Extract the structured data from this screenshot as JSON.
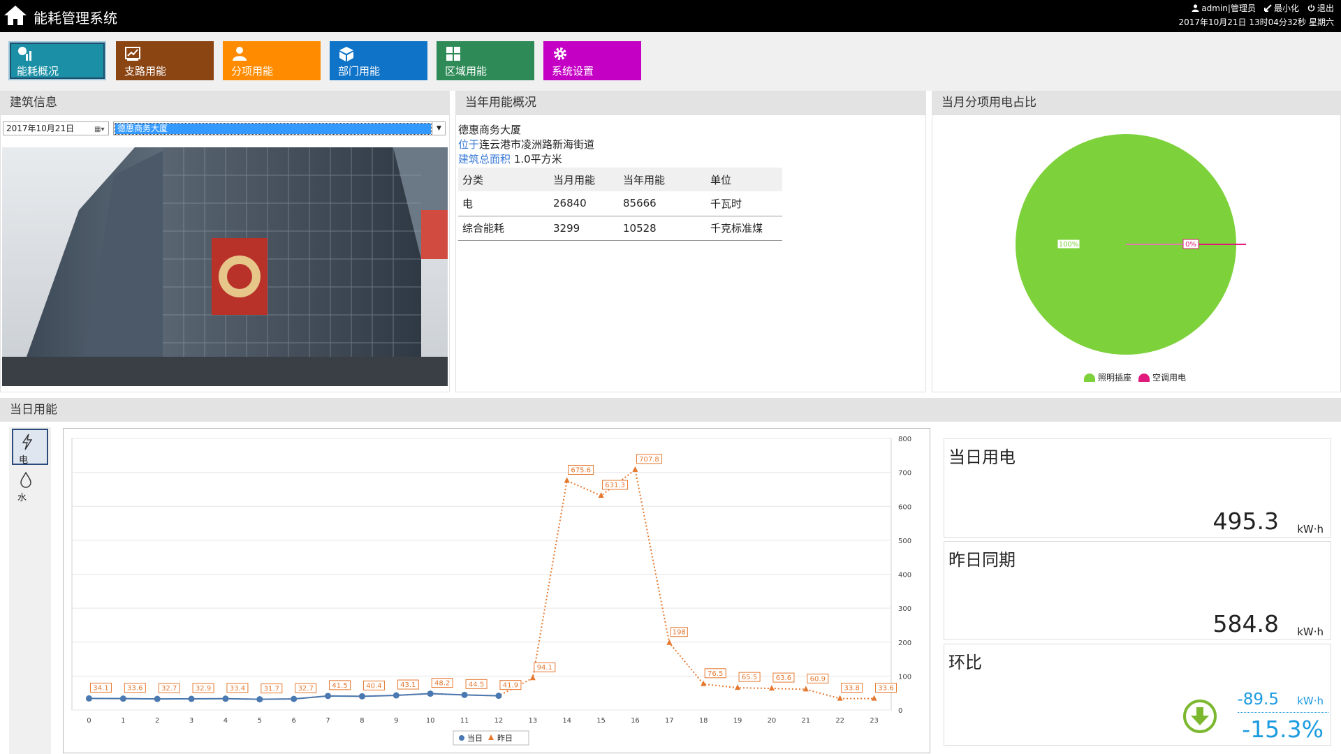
{
  "app": {
    "title": "能耗管理系统"
  },
  "user": {
    "user_label": "admin|管理员",
    "minimize_label": "最小化",
    "logout_label": "退出",
    "datetime": "2017年10月21日 13时04分32秒 星期六"
  },
  "nav": [
    {
      "label": "能耗概况",
      "color": "#1a8fa5",
      "icon": "dashboard-chart-icon",
      "active": true
    },
    {
      "label": "支路用能",
      "color": "#8b4513",
      "icon": "trend-chart-icon"
    },
    {
      "label": "分项用能",
      "color": "#ff8c00",
      "icon": "person-icon"
    },
    {
      "label": "部门用能",
      "color": "#0f73c8",
      "icon": "cube-icon"
    },
    {
      "label": "区域用能",
      "color": "#2e8b57",
      "icon": "grid-icon"
    },
    {
      "label": "系统设置",
      "color": "#c500c5",
      "icon": "gear-icon"
    }
  ],
  "building": {
    "header": "建筑信息",
    "date": "2017年10月21日",
    "selected": "德惠商务大厦"
  },
  "annual": {
    "header": "当年用能概况",
    "name": "德惠商务大厦",
    "loc_label": "位于",
    "loc_value": "连云港市凌洲路新海街道",
    "area_label": "建筑总面积",
    "area_value": " 1.0平方米",
    "columns": [
      "分类",
      "当月用能",
      "当年用能",
      "单位"
    ],
    "rows": [
      [
        "电",
        "26840",
        "85666",
        "千瓦时"
      ],
      [
        "综合能耗",
        "3299",
        "10528",
        "千克标准煤"
      ]
    ]
  },
  "pie": {
    "header": "当月分项用电占比",
    "chart_data": {
      "type": "pie",
      "slices": [
        {
          "name": "照明插座",
          "value": 100,
          "label": "100%",
          "color": "#7dd13a"
        },
        {
          "name": "空调用电",
          "value": 0,
          "label": "0%",
          "color": "#e01a7c"
        }
      ]
    }
  },
  "daily": {
    "header": "当日用能",
    "tabs": [
      {
        "label": "电",
        "icon": "lightning-icon"
      },
      {
        "label": "水",
        "icon": "water-drop-icon"
      }
    ],
    "legend": [
      "当日",
      "昨日"
    ]
  },
  "chart_data": {
    "type": "line",
    "x": [
      0,
      1,
      2,
      3,
      4,
      5,
      6,
      7,
      8,
      9,
      10,
      11,
      12,
      13,
      14,
      15,
      16,
      17,
      18,
      19,
      20,
      21,
      22,
      23
    ],
    "ylim": [
      0,
      800
    ],
    "yticks": [
      0,
      100,
      200,
      300,
      400,
      500,
      600,
      700,
      800
    ],
    "grid": true,
    "legend_position": "bottom",
    "series": [
      {
        "name": "当日",
        "color": "#4a78b0",
        "values": [
          34.1,
          33.6,
          32.7,
          32.9,
          33.4,
          31.7,
          32.7,
          41.5,
          40.4,
          43.1,
          48.2,
          44.5,
          41.9
        ]
      },
      {
        "name": "昨日",
        "color": "#e5782f",
        "values": [
          34.1,
          33.6,
          32.7,
          32.9,
          33.4,
          31.7,
          32.7,
          41.5,
          40.4,
          43.1,
          48.2,
          44.5,
          41.9,
          94.1,
          675.6,
          631.3,
          707.8,
          198,
          76.5,
          65.5,
          63.6,
          60.9,
          33.8,
          33.6
        ]
      }
    ]
  },
  "kpi": {
    "today_title": "当日用电",
    "today_value": "495.3",
    "today_unit": "kW·h",
    "yest_title": "昨日同期",
    "yest_value": "584.8",
    "yest_unit": "kW·h",
    "ring_title": "环比",
    "ring_value": "-89.5",
    "ring_unit": "kW·h",
    "ring_pct": "-15.3%",
    "down_color": "#7cb82f"
  }
}
